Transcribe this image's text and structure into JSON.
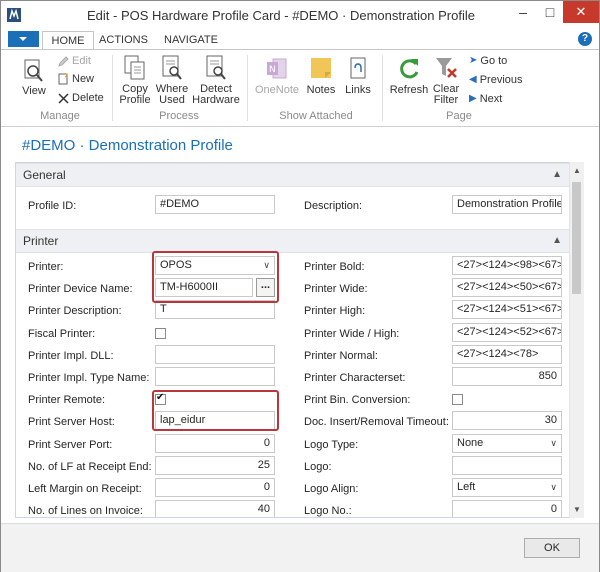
{
  "window": {
    "title": "Edit - POS Hardware Profile Card - #DEMO · Demonstration Profile",
    "minimize": "–",
    "maximize": "□",
    "close": "✕"
  },
  "tabs": [
    "HOME",
    "ACTIONS",
    "NAVIGATE"
  ],
  "help": "?",
  "ribbon": {
    "manage": {
      "group": "Manage",
      "view": "View",
      "edit": "Edit",
      "new": "New",
      "delete": "Delete"
    },
    "process": {
      "group": "Process",
      "copy_profile": [
        "Copy",
        "Profile"
      ],
      "where_used": [
        "Where",
        "Used"
      ],
      "detect_hardware": [
        "Detect",
        "Hardware"
      ]
    },
    "show_attached": {
      "group": "Show Attached",
      "onenote": "OneNote",
      "notes": "Notes",
      "links": "Links"
    },
    "page": {
      "group": "Page",
      "refresh": "Refresh",
      "clear_filter": [
        "Clear",
        "Filter"
      ],
      "go_to": "Go to",
      "previous": "Previous",
      "next": "Next"
    }
  },
  "page_title": "#DEMO · Demonstration Profile",
  "general": {
    "header": "General",
    "profile_id_label": "Profile ID:",
    "profile_id": "#DEMO",
    "description_label": "Description:",
    "description": "Demonstration Profile"
  },
  "printer": {
    "header": "Printer",
    "left": [
      {
        "label": "Printer:",
        "value": "OPOS",
        "kind": "select"
      },
      {
        "label": "Printer Device Name:",
        "value": "TM-H6000II",
        "kind": "lookup"
      },
      {
        "label": "Printer Description:",
        "value": "T",
        "kind": "text"
      },
      {
        "label": "Fiscal Printer:",
        "value": false,
        "kind": "check"
      },
      {
        "label": "Printer Impl. DLL:",
        "value": "",
        "kind": "text"
      },
      {
        "label": "Printer Impl. Type Name:",
        "value": "",
        "kind": "text"
      },
      {
        "label": "Printer Remote:",
        "value": true,
        "kind": "check"
      },
      {
        "label": "Print Server Host:",
        "value": "lap_eidur",
        "kind": "text"
      },
      {
        "label": "Print Server Port:",
        "value": "0",
        "kind": "num"
      },
      {
        "label": "No. of LF at Receipt End:",
        "value": "25",
        "kind": "num"
      },
      {
        "label": "Left Margin on Receipt:",
        "value": "0",
        "kind": "num"
      },
      {
        "label": "No. of Lines on Invoice:",
        "value": "40",
        "kind": "num"
      }
    ],
    "right": [
      {
        "label": "Printer Bold:",
        "value": "<27><124><98><67>",
        "kind": "text"
      },
      {
        "label": "Printer Wide:",
        "value": "<27><124><50><67>",
        "kind": "text"
      },
      {
        "label": "Printer High:",
        "value": "<27><124><51><67>",
        "kind": "text"
      },
      {
        "label": "Printer Wide / High:",
        "value": "<27><124><52><67>",
        "kind": "text"
      },
      {
        "label": "Printer Normal:",
        "value": "<27><124><78>",
        "kind": "text"
      },
      {
        "label": "Printer Characterset:",
        "value": "850",
        "kind": "num"
      },
      {
        "label": "Print Bin. Conversion:",
        "value": false,
        "kind": "check"
      },
      {
        "label": "Doc. Insert/Removal Timeout:",
        "value": "30",
        "kind": "num"
      },
      {
        "label": "Logo Type:",
        "value": "None",
        "kind": "select"
      },
      {
        "label": "Logo:",
        "value": "",
        "kind": "text"
      },
      {
        "label": "Logo Align:",
        "value": "Left",
        "kind": "select"
      },
      {
        "label": "Logo No.:",
        "value": "0",
        "kind": "num"
      }
    ]
  },
  "ok": "OK",
  "lookup_glyph": "...",
  "colors": {
    "accent": "#1a6fb7",
    "highlight": "#b8363c"
  }
}
